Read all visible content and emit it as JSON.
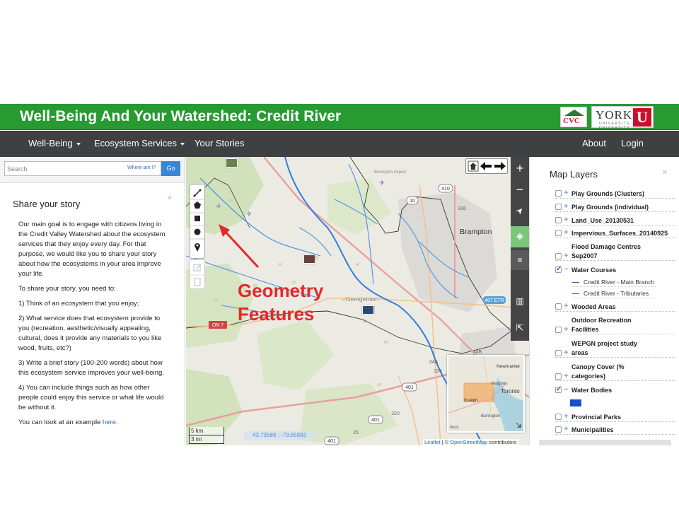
{
  "header": {
    "title": "Well-Being And Your Watershed: Credit River",
    "logo_cvc_text": "CVC",
    "logo_york_text": "YORK",
    "logo_york_u": "U",
    "logo_york_sub": "UNIVERSITÉ UNIVERSITY",
    "background_color": "#279a32"
  },
  "nav": {
    "items": [
      {
        "label": "Well-Being",
        "dropdown": true
      },
      {
        "label": "Ecosystem Services",
        "dropdown": true
      },
      {
        "label": "Your Stories",
        "dropdown": false
      }
    ],
    "right_items": [
      {
        "label": "About"
      },
      {
        "label": "Login"
      }
    ]
  },
  "search": {
    "placeholder": "Search",
    "where_link": "Where am I?",
    "go_label": "Go"
  },
  "story": {
    "title": "Share your story",
    "close_icon": "×",
    "paragraphs": [
      "Our main goal is to engage with citizens living in the Credit Valley Watershed about the ecosystem services that they enjoy every day. For that purpose, we would like you to share your story about how the ecosystems in your area improve your life.",
      "To share your story, you need to:",
      "1) Think of an ecosystem that you enjoy;",
      "2) What service does that ecosystem provide to you (recreation, aesthetic/visually appealing, cultural, does it provide any materials to you like wood, fruits, etc?)",
      "3) Write a brief story (100-200 words) about how this ecosystem service improves your well-being.",
      "4) You can include things such as how other people could enjoy this service or what life would be without it."
    ],
    "example_prefix": "You can look at an example ",
    "example_link": "here",
    "example_suffix": "."
  },
  "map": {
    "annotation_line1": "Geometry",
    "annotation_line2": "Features",
    "annotation_color": "#e32929",
    "place_labels": [
      "Brampton",
      "Georgetown",
      "Brampton Airport",
      "Toronto",
      "Newmarket",
      "Vaughan",
      "Guelph",
      "Burlington",
      "Milton"
    ],
    "highway_labels": [
      "410",
      "10",
      "7",
      "407 ETR",
      "407 ETR",
      "401",
      "401",
      "401",
      "ON 7",
      "15",
      "336",
      "34B",
      "34A",
      "324",
      "320",
      "25"
    ],
    "scale_km": "5 km",
    "scale_mi": "3 mi",
    "coordinates": "43.73588 : -79.65893",
    "attribution_leaflet": "Leaflet",
    "attribution_sep": " | © ",
    "attribution_osm": "OpenStreetMap",
    "attribution_suffix": " contributors",
    "minimap_labels": [
      "Newmarket",
      "Vaughan",
      "Toronto",
      "Guelph",
      "Burlington",
      "itock"
    ],
    "draw_tools": [
      "polyline-icon",
      "polygon-icon",
      "rectangle-icon",
      "circle-icon",
      "marker-icon"
    ],
    "edit_tools": [
      "edit-icon",
      "delete-icon"
    ],
    "right_tools": [
      {
        "icon": "zoom-in-icon",
        "glyph": "+"
      },
      {
        "icon": "zoom-out-icon",
        "glyph": "−"
      },
      {
        "icon": "locate-icon",
        "glyph": "➤"
      },
      {
        "icon": "layers-icon",
        "glyph": "◈"
      },
      {
        "icon": "legend-icon",
        "glyph": "≡"
      },
      {
        "icon": "chart-icon",
        "glyph": "▥"
      },
      {
        "icon": "share-icon",
        "glyph": "⇱"
      }
    ]
  },
  "layers": {
    "title": "Map Layers",
    "close_icon": "×",
    "items": [
      {
        "label": "Play Grounds (Clusters)",
        "checked": false,
        "expanded": false
      },
      {
        "label": "Play Grounds (individual)",
        "checked": false,
        "expanded": false
      },
      {
        "label": "Land_Use_20130531",
        "checked": false,
        "expanded": false
      },
      {
        "label": "Impervious_Surfaces_20140925",
        "checked": false,
        "expanded": false
      },
      {
        "label_top": "Flood Damage Centres",
        "label": "Sep2007",
        "checked": false,
        "expanded": false
      },
      {
        "label": "Water Courses",
        "checked": true,
        "expanded": true
      },
      {
        "label": "Wooded Areas",
        "checked": false,
        "expanded": false
      },
      {
        "label_top": "Outdoor Recreation",
        "label": "Facilities",
        "checked": false,
        "expanded": false
      },
      {
        "label_top": "WEPGN project study",
        "label": "areas",
        "checked": false,
        "expanded": false
      },
      {
        "label_top": "Canopy Cover (%",
        "label": "categories)",
        "checked": false,
        "expanded": false
      },
      {
        "label": "Water Bodies",
        "checked": true,
        "expanded": true
      },
      {
        "label": "Provincial Parks",
        "checked": false,
        "expanded": false
      },
      {
        "label": "Municipalities",
        "checked": false,
        "expanded": false
      }
    ],
    "water_course_subitems": [
      "Credit River - Main Branch",
      "Credit River - Tributaries"
    ],
    "water_bodies_color": "#1a4fc6"
  }
}
